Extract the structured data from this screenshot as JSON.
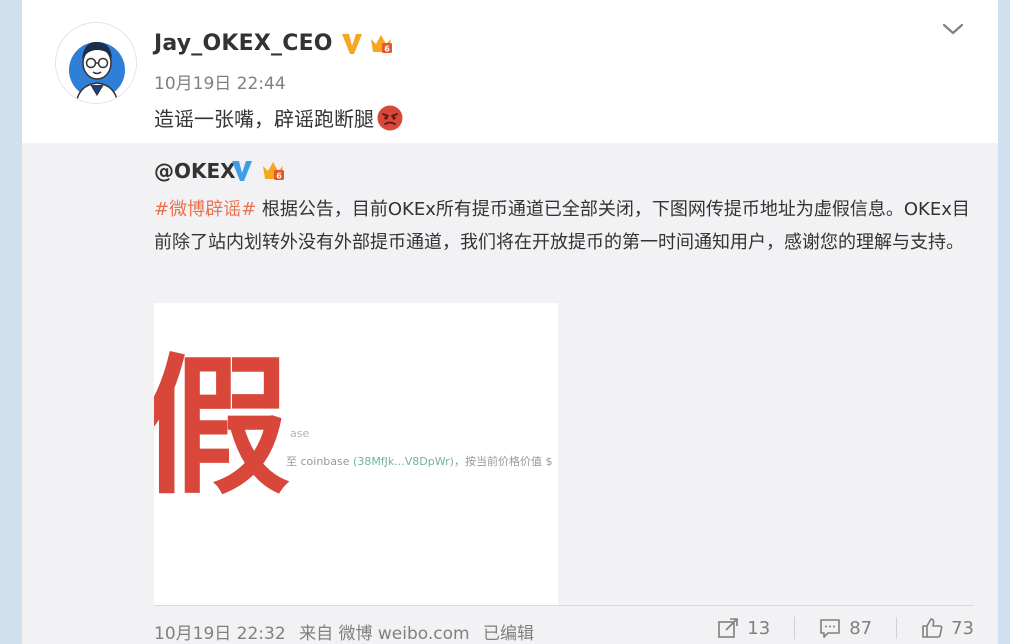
{
  "post": {
    "username": "Jay_OKEX_CEO",
    "time": "10月19日 22:44",
    "text": "造谣一张嘴，辟谣跑断腿"
  },
  "icons": {
    "verified": "verified-v-icon",
    "crown": "member-crown-icon",
    "menu": "chevron-down-icon",
    "emoji": "angry-face-emoji-icon",
    "share": "share-icon",
    "comment": "comment-icon",
    "like": "like-icon"
  },
  "colors": {
    "verified_yellow": "#f5a623",
    "verified_blue": "#3d9ee5",
    "hashtag": "#eb7350",
    "fake_red": "#d9473b"
  },
  "repost": {
    "author": "@OKEX",
    "hashtag": "#微博辟谣#",
    "text": " 根据公告，目前OKEx所有提币通道已全部关闭，下图网传提币地址为虚假信息。OKEx目前除了站内划转外没有外部提币通道，我们将在开放提币的第一时间通知用户，感谢您的理解与支持。",
    "image": {
      "big_char": "假",
      "small_text": "ase",
      "line_prefix": "至 coinbase",
      "line_addr": "(38MfJk...V8DpWr)",
      "line_suffix": "，按当前价格价值 $"
    },
    "footer": {
      "time": "10月19日 22:32",
      "source": "来自 微博 weibo.com",
      "edited": "已编辑"
    },
    "actions": {
      "shares": "13",
      "comments": "87",
      "likes": "73"
    }
  }
}
